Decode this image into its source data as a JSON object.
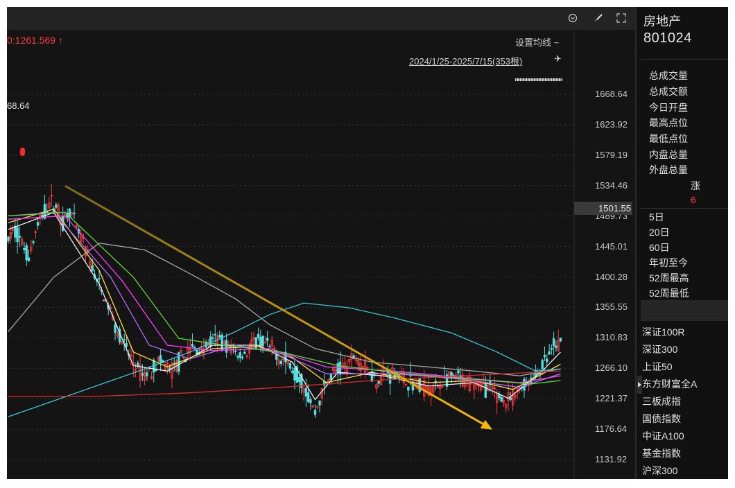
{
  "toolbar": {
    "icons": [
      "clock-icon",
      "brush-icon",
      "fullscreen-icon"
    ],
    "ma_label": "0:1261.569 ↑",
    "ma_setting": "设置均线 ~",
    "date_range": "2024/1/25-2025/7/15(353根)",
    "high_marker": "68.64"
  },
  "sidebar": {
    "name": "房地产",
    "code": "801024",
    "stats": [
      "总成交量",
      "总成交额",
      "今日开盘",
      "最高点位",
      "最低点位",
      "内盘总量",
      "外盘总量"
    ],
    "zhang_label": "涨",
    "zhang_value": "6",
    "periods": [
      "5日",
      "20日",
      "60日",
      "年初至今",
      "52周最高",
      "52周最低"
    ],
    "indices": [
      "深证100R",
      "深证300",
      "上证50",
      "东方财富全A",
      "三板成指",
      "国债指数",
      "中证A100",
      "基金指数",
      "沪深300"
    ]
  },
  "chart_data": {
    "type": "line",
    "title": "",
    "current_price": "1501.55",
    "y_ticks": [
      "1668.64",
      "1623.92",
      "1579.19",
      "1534.46",
      "1489.73",
      "1445.01",
      "1400.28",
      "1355.55",
      "1310.83",
      "1266.10",
      "1221.37",
      "1176.64",
      "1131.92"
    ],
    "ylim": [
      1131.92,
      1668.64
    ],
    "x_range": "2024/1/25-2025/7/15",
    "bars": 353,
    "price_path": [
      [
        0,
        1455
      ],
      [
        3,
        1470
      ],
      [
        6,
        1450
      ],
      [
        9,
        1430
      ],
      [
        12,
        1465
      ],
      [
        15,
        1490
      ],
      [
        18,
        1510
      ],
      [
        21,
        1505
      ],
      [
        24,
        1480
      ],
      [
        27,
        1500
      ],
      [
        30,
        1470
      ],
      [
        33,
        1450
      ],
      [
        36,
        1420
      ],
      [
        39,
        1395
      ],
      [
        42,
        1370
      ],
      [
        45,
        1350
      ],
      [
        48,
        1320
      ],
      [
        51,
        1300
      ],
      [
        54,
        1280
      ],
      [
        57,
        1262
      ],
      [
        60,
        1255
      ],
      [
        63,
        1265
      ],
      [
        66,
        1275
      ],
      [
        69,
        1270
      ],
      [
        72,
        1262
      ],
      [
        75,
        1275
      ],
      [
        78,
        1285
      ],
      [
        81,
        1295
      ],
      [
        84,
        1292
      ],
      [
        87,
        1300
      ],
      [
        90,
        1305
      ],
      [
        93,
        1310
      ],
      [
        96,
        1298
      ],
      [
        99,
        1292
      ],
      [
        102,
        1285
      ],
      [
        105,
        1290
      ],
      [
        108,
        1302
      ],
      [
        111,
        1306
      ],
      [
        114,
        1298
      ],
      [
        117,
        1292
      ],
      [
        120,
        1280
      ],
      [
        123,
        1275
      ],
      [
        126,
        1260
      ],
      [
        129,
        1250
      ],
      [
        132,
        1225
      ],
      [
        135,
        1200
      ],
      [
        138,
        1230
      ],
      [
        141,
        1250
      ],
      [
        144,
        1262
      ],
      [
        147,
        1265
      ],
      [
        150,
        1275
      ],
      [
        153,
        1285
      ],
      [
        156,
        1270
      ],
      [
        159,
        1262
      ],
      [
        162,
        1250
      ],
      [
        165,
        1255
      ],
      [
        168,
        1258
      ],
      [
        171,
        1260
      ],
      [
        174,
        1248
      ],
      [
        177,
        1245
      ],
      [
        180,
        1240
      ],
      [
        183,
        1238
      ],
      [
        186,
        1235
      ],
      [
        189,
        1240
      ],
      [
        192,
        1247
      ],
      [
        195,
        1250
      ],
      [
        198,
        1252
      ],
      [
        201,
        1245
      ],
      [
        204,
        1248
      ],
      [
        207,
        1243
      ],
      [
        210,
        1238
      ],
      [
        213,
        1232
      ],
      [
        216,
        1225
      ],
      [
        219,
        1215
      ],
      [
        222,
        1222
      ],
      [
        225,
        1235
      ],
      [
        228,
        1245
      ],
      [
        231,
        1250
      ],
      [
        234,
        1265
      ],
      [
        237,
        1280
      ],
      [
        240,
        1296
      ],
      [
        243,
        1302
      ]
    ],
    "series": [
      {
        "color": "#f0f0f0",
        "values": [
          [
            0,
            1470
          ],
          [
            20,
            1495
          ],
          [
            40,
            1390
          ],
          [
            55,
            1270
          ],
          [
            70,
            1262
          ],
          [
            90,
            1300
          ],
          [
            110,
            1300
          ],
          [
            125,
            1275
          ],
          [
            135,
            1220
          ],
          [
            145,
            1260
          ],
          [
            165,
            1255
          ],
          [
            185,
            1240
          ],
          [
            205,
            1245
          ],
          [
            220,
            1222
          ],
          [
            235,
            1262
          ],
          [
            243,
            1290
          ]
        ]
      },
      {
        "color": "#ffe040",
        "values": [
          [
            0,
            1480
          ],
          [
            20,
            1500
          ],
          [
            40,
            1410
          ],
          [
            55,
            1290
          ],
          [
            70,
            1268
          ],
          [
            90,
            1295
          ],
          [
            110,
            1298
          ],
          [
            125,
            1282
          ],
          [
            140,
            1245
          ],
          [
            160,
            1260
          ],
          [
            185,
            1245
          ],
          [
            205,
            1248
          ],
          [
            222,
            1235
          ],
          [
            243,
            1272
          ]
        ]
      },
      {
        "color": "#b46cff",
        "values": [
          [
            0,
            1490
          ],
          [
            20,
            1495
          ],
          [
            45,
            1400
          ],
          [
            62,
            1300
          ],
          [
            80,
            1280
          ],
          [
            100,
            1300
          ],
          [
            120,
            1288
          ],
          [
            140,
            1258
          ],
          [
            170,
            1258
          ],
          [
            200,
            1250
          ],
          [
            225,
            1238
          ],
          [
            243,
            1258
          ]
        ]
      },
      {
        "color": "#ff3cff",
        "values": [
          [
            0,
            1485
          ],
          [
            25,
            1490
          ],
          [
            50,
            1395
          ],
          [
            70,
            1300
          ],
          [
            90,
            1292
          ],
          [
            115,
            1295
          ],
          [
            140,
            1268
          ],
          [
            170,
            1262
          ],
          [
            200,
            1252
          ],
          [
            225,
            1245
          ],
          [
            243,
            1255
          ]
        ]
      },
      {
        "color": "#5fdc3c",
        "values": [
          [
            0,
            1490
          ],
          [
            25,
            1495
          ],
          [
            55,
            1400
          ],
          [
            75,
            1310
          ],
          [
            95,
            1300
          ],
          [
            120,
            1290
          ],
          [
            145,
            1270
          ],
          [
            175,
            1258
          ],
          [
            205,
            1250
          ],
          [
            230,
            1243
          ],
          [
            243,
            1248
          ]
        ]
      },
      {
        "color": "#a8a8a8",
        "values": [
          [
            0,
            1320
          ],
          [
            20,
            1400
          ],
          [
            40,
            1450
          ],
          [
            60,
            1440
          ],
          [
            80,
            1405
          ],
          [
            100,
            1368
          ],
          [
            115,
            1330
          ],
          [
            135,
            1295
          ],
          [
            160,
            1275
          ],
          [
            185,
            1268
          ],
          [
            205,
            1262
          ],
          [
            225,
            1255
          ],
          [
            243,
            1265
          ]
        ]
      },
      {
        "color": "#38c8d8",
        "values": [
          [
            0,
            1195
          ],
          [
            30,
            1230
          ],
          [
            60,
            1265
          ],
          [
            80,
            1290
          ],
          [
            100,
            1320
          ],
          [
            115,
            1345
          ],
          [
            130,
            1362
          ],
          [
            150,
            1355
          ],
          [
            170,
            1340
          ],
          [
            195,
            1318
          ],
          [
            215,
            1290
          ],
          [
            232,
            1262
          ],
          [
            243,
            1265
          ]
        ]
      },
      {
        "color": "#e02a2a",
        "values": [
          [
            0,
            1225
          ],
          [
            40,
            1225
          ],
          [
            80,
            1230
          ],
          [
            120,
            1238
          ],
          [
            160,
            1248
          ],
          [
            200,
            1255
          ],
          [
            243,
            1262
          ]
        ]
      }
    ],
    "trend_arrow": {
      "from": [
        25,
        1534
      ],
      "to": [
        213,
        1176
      ],
      "colors": [
        "#7a6a20",
        "#f5b800"
      ]
    }
  }
}
